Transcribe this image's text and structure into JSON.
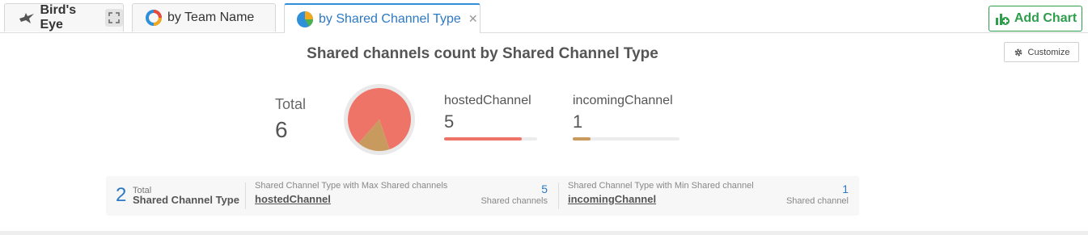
{
  "tabs": [
    {
      "label": "Bird's Eye",
      "icon": "bird-icon"
    },
    {
      "label": "by Team Name",
      "icon": "donut-chart-icon"
    },
    {
      "label": "by Shared Channel Type",
      "icon": "pie-chart-icon",
      "active": true
    }
  ],
  "toolbar": {
    "add_chart_label": "Add Chart",
    "customize_label": "Customize"
  },
  "chart_data": {
    "type": "pie",
    "title": "Shared channels count by Shared Channel Type",
    "total_label": "Total",
    "total_value": "6",
    "categories": [
      "hostedChannel",
      "incomingChannel"
    ],
    "values": [
      5,
      1
    ],
    "colors": [
      "#ee7468",
      "#c89a5e"
    ]
  },
  "summary": {
    "count": "2",
    "total_label": "Total",
    "type_label": "Shared Channel Type",
    "max": {
      "label": "Shared Channel Type with Max Shared channels",
      "name": "hostedChannel",
      "value": "5",
      "unit": "Shared channels"
    },
    "min": {
      "label": "Shared Channel Type with Min Shared channel",
      "name": "incomingChannel",
      "value": "1",
      "unit": "Shared channel"
    }
  },
  "colors": {
    "accent": "#2d79c4",
    "add_chart": "#2e9e4d"
  }
}
